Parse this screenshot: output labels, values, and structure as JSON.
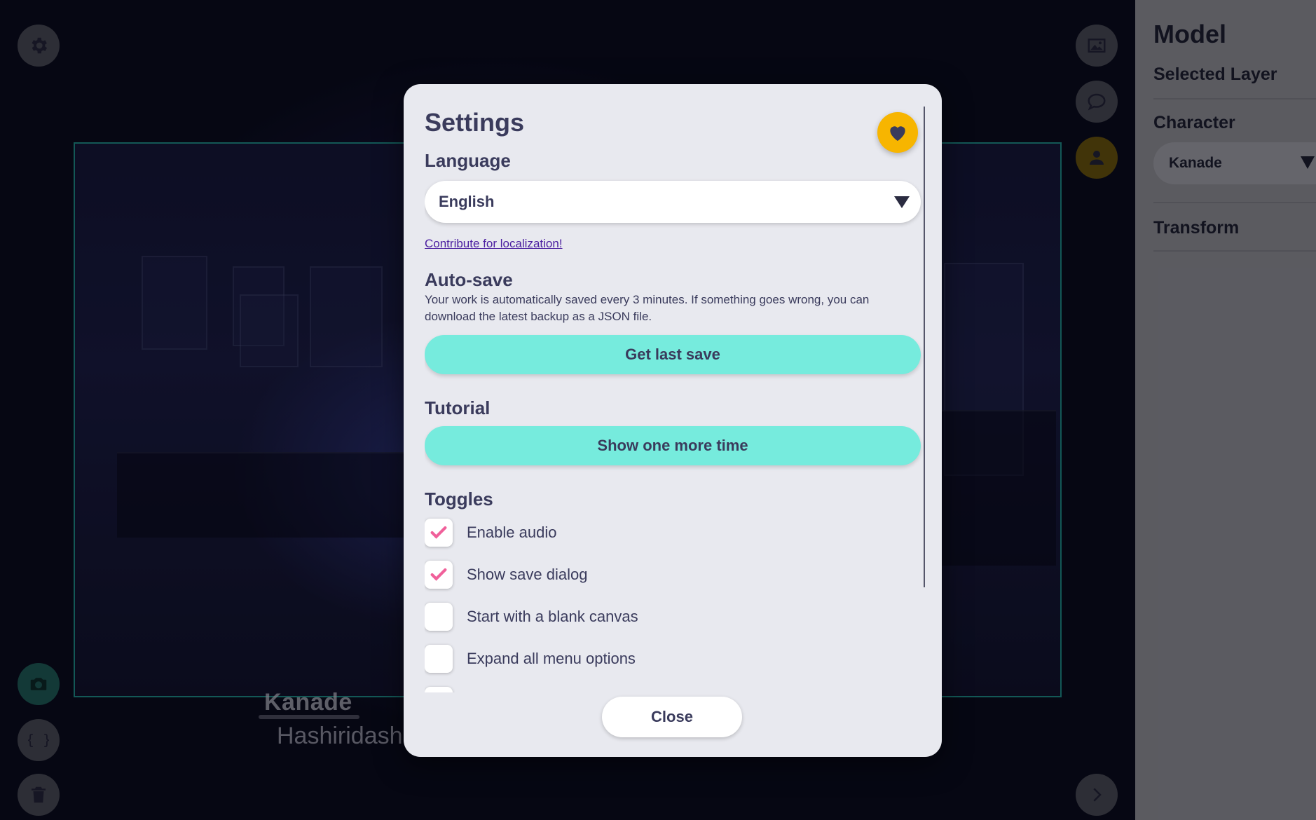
{
  "canvas": {
    "speaker_name": "Kanade",
    "dialogue_line": "Hashiridashita...?"
  },
  "toolbar_left": [
    {
      "icon": "gear-icon"
    },
    {
      "icon": "camera-icon"
    },
    {
      "icon": "braces-icon"
    },
    {
      "icon": "trash-icon"
    }
  ],
  "toolbar_right": [
    {
      "icon": "image-icon"
    },
    {
      "icon": "speech-bubble-icon"
    },
    {
      "icon": "user-icon"
    },
    {
      "icon": "chevron-right-icon"
    }
  ],
  "side_panel": {
    "title": "Model",
    "selected_layer_label": "Selected Layer",
    "character_label": "Character",
    "character_value": "Kanade",
    "transform_label": "Transform"
  },
  "settings": {
    "title": "Settings",
    "heart_icon": "heart-icon",
    "language": {
      "heading": "Language",
      "selected": "English",
      "link": "Contribute for localization!"
    },
    "autosave": {
      "heading": "Auto-save",
      "description": "Your work is automatically saved every 3 minutes. If something goes wrong, you can download the latest backup as a JSON file.",
      "button": "Get last save"
    },
    "tutorial": {
      "heading": "Tutorial",
      "button": "Show one more time"
    },
    "toggles": {
      "heading": "Toggles",
      "items": [
        {
          "label": "Enable audio",
          "checked": true
        },
        {
          "label": "Show save dialog",
          "checked": true
        },
        {
          "label": "Start with a blank canvas",
          "checked": false
        },
        {
          "label": "Expand all menu options",
          "checked": false
        }
      ]
    },
    "close_button": "Close"
  },
  "colors": {
    "accent_teal": "#76ebdd",
    "heart_yellow": "#f7b500",
    "check_pink": "#f0609a",
    "text_dark": "#3a3b5c"
  }
}
